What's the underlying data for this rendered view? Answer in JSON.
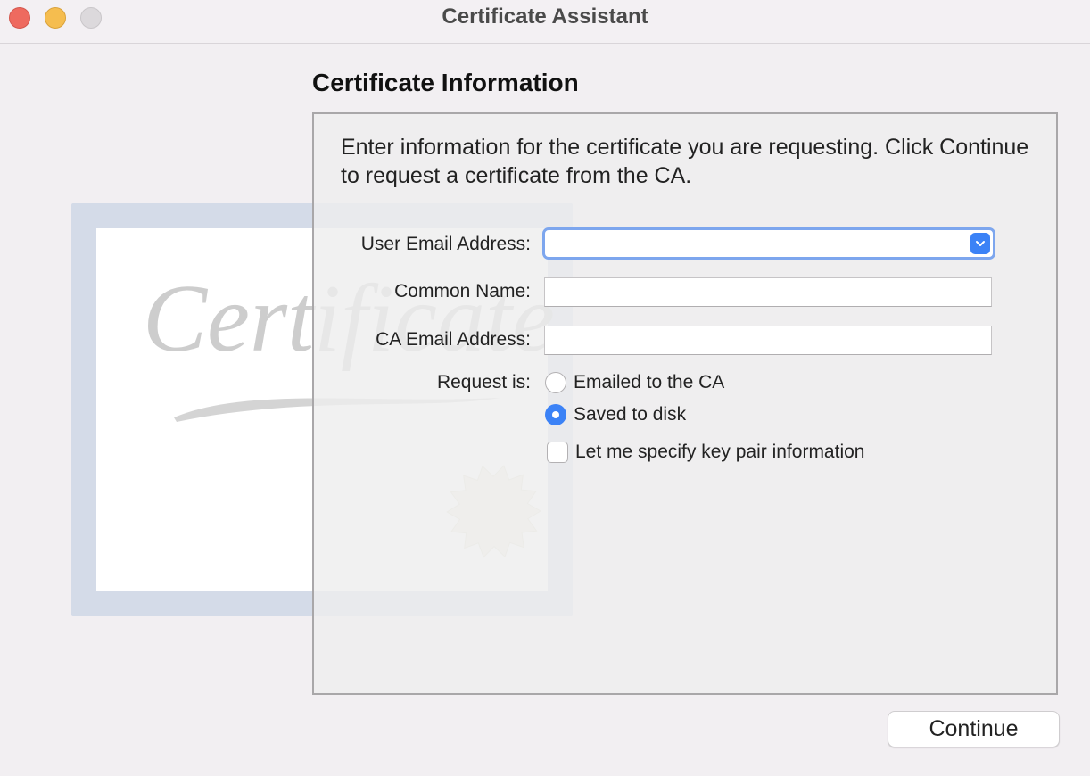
{
  "window": {
    "title": "Certificate Assistant"
  },
  "section": {
    "title": "Certificate Information"
  },
  "description": "Enter information for the certificate you are requesting. Click Continue to request a certificate from the CA.",
  "form": {
    "user_email_label": "User Email Address:",
    "user_email_value": "",
    "common_name_label": "Common Name:",
    "common_name_value": "",
    "ca_email_label": "CA Email Address:",
    "ca_email_value": "",
    "request_label": "Request is:",
    "options": [
      {
        "label": "Emailed to the CA",
        "selected": false
      },
      {
        "label": "Saved to disk",
        "selected": true
      }
    ],
    "key_pair_label": "Let me specify key pair information",
    "key_pair_checked": false
  },
  "buttons": {
    "continue": "Continue"
  },
  "decoration": {
    "certificate_art_text": "Certificate"
  },
  "colors": {
    "accent": "#3b82f6",
    "close": "#ee6a5f",
    "minimize": "#f5bd4f",
    "zoom": "#dcd9dc"
  }
}
